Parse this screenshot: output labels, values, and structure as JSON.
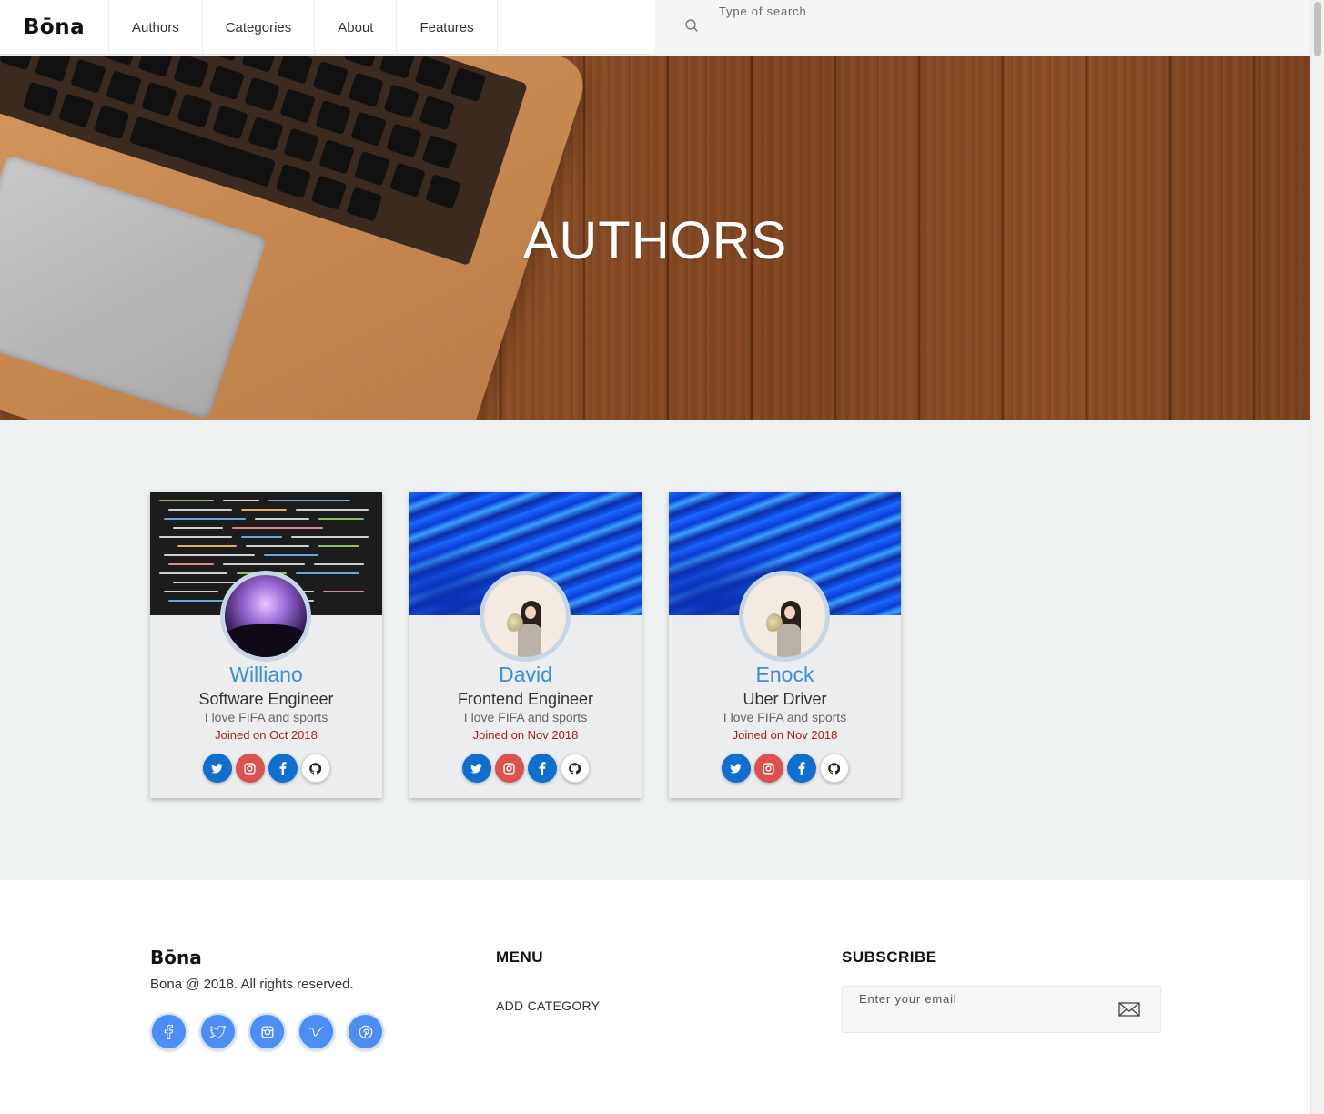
{
  "header": {
    "logo": "Bōna",
    "nav": [
      "Authors",
      "Categories",
      "About",
      "Features"
    ],
    "search_placeholder": "Type of search"
  },
  "hero": {
    "title": "AUTHORS"
  },
  "authors": [
    {
      "name": "Williano",
      "role": "Software Engineer",
      "bio": "I love FIFA and sports",
      "joined": "Joined on Oct 2018",
      "cover": "code-screen",
      "avatar": "concert-crowd"
    },
    {
      "name": "David",
      "role": "Frontend Engineer",
      "bio": "I love FIFA and sports",
      "joined": "Joined on Nov 2018",
      "cover": "blue-wave",
      "avatar": "girl-with-flowers"
    },
    {
      "name": "Enock",
      "role": "Uber Driver",
      "bio": "I love FIFA and sports",
      "joined": "Joined on Nov 2018",
      "cover": "blue-wave",
      "avatar": "girl-with-flowers"
    }
  ],
  "card_social_icons": [
    "twitter-icon",
    "instagram-icon",
    "facebook-icon",
    "github-icon"
  ],
  "footer": {
    "logo": "Bōna",
    "copyright": "Bona @ 2018. All rights reserved.",
    "social_icons": [
      "facebook-icon",
      "twitter-icon",
      "instagram-icon",
      "vimeo-icon",
      "pinterest-icon"
    ],
    "menu_title": "MENU",
    "menu_links": [
      "ADD CATEGORY"
    ],
    "subscribe_title": "SUBSCRIBE",
    "subscribe_placeholder": "Enter your email"
  },
  "colors": {
    "name_blue": "#3d8fd4",
    "joined_red": "#b21a1a",
    "social_blue": "#0f6fcf",
    "social_red": "#db5250",
    "footer_social_blue": "#4c8ef5",
    "page_bg": "#edf1f1"
  }
}
